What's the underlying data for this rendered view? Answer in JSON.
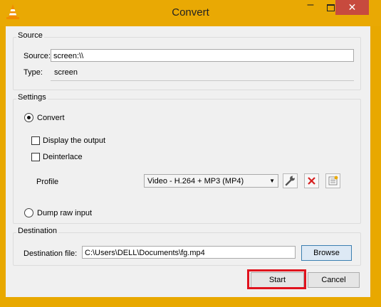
{
  "window": {
    "title": "Convert",
    "app_icon": "vlc-cone-icon",
    "controls": {
      "minimize": "–",
      "maximize": "maximize-icon",
      "close": "✕"
    }
  },
  "source": {
    "group_title": "Source",
    "source_label": "Source:",
    "source_value": "screen:\\\\",
    "type_label": "Type:",
    "type_value": "screen"
  },
  "settings": {
    "group_title": "Settings",
    "convert_label": "Convert",
    "convert_selected": true,
    "display_output_label": "Display the output",
    "display_output_checked": false,
    "deinterlace_label": "Deinterlace",
    "deinterlace_checked": false,
    "profile_label": "Profile",
    "profile_value": "Video - H.264 + MP3 (MP4)",
    "dump_raw_label": "Dump raw input",
    "dump_raw_selected": false
  },
  "destination": {
    "group_title": "Destination",
    "file_label": "Destination file:",
    "file_value": "C:\\Users\\DELL\\Documents\\fg.mp4",
    "browse_label": "Browse"
  },
  "buttons": {
    "start_label": "Start",
    "cancel_label": "Cancel"
  },
  "colors": {
    "titlebar": "#e9a904",
    "close_button": "#c74a3e",
    "highlight": "#e0121d",
    "delete_icon": "#d62020"
  }
}
